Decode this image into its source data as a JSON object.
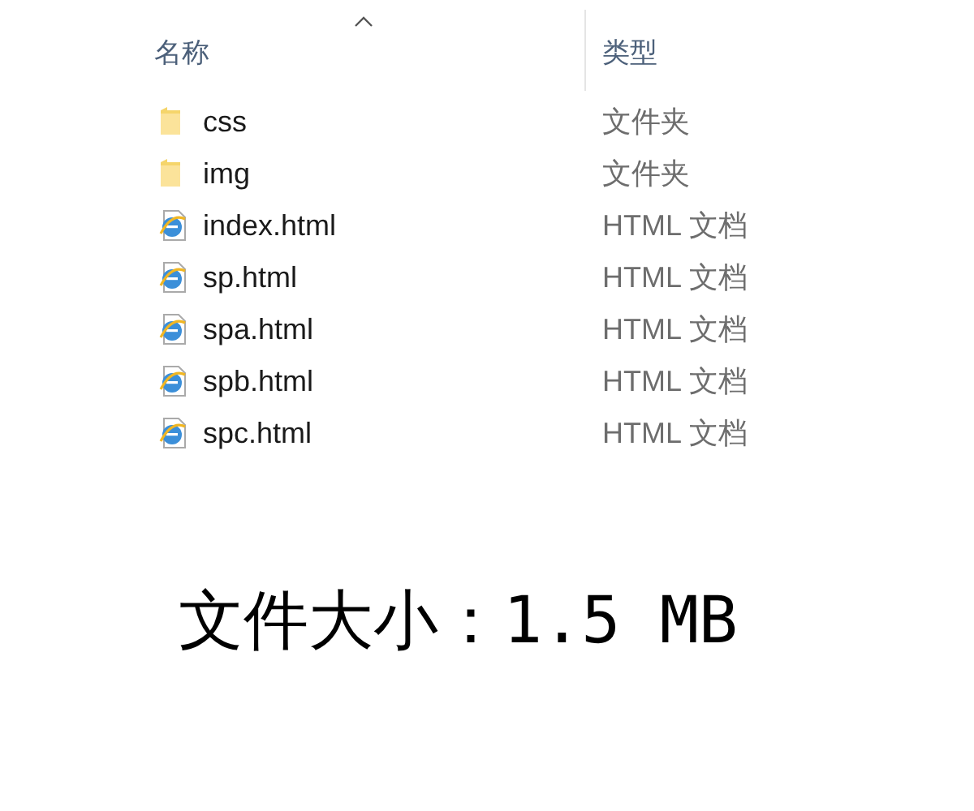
{
  "columns": [
    {
      "label": "名称",
      "sorted": true
    },
    {
      "label": "类型",
      "sorted": false
    }
  ],
  "files": [
    {
      "kind": "folder",
      "name": "css",
      "type": "文件夹"
    },
    {
      "kind": "folder",
      "name": "img",
      "type": "文件夹"
    },
    {
      "kind": "html",
      "name": "index.html",
      "type": "HTML 文档"
    },
    {
      "kind": "html",
      "name": "sp.html",
      "type": "HTML 文档"
    },
    {
      "kind": "html",
      "name": "spa.html",
      "type": "HTML 文档"
    },
    {
      "kind": "html",
      "name": "spb.html",
      "type": "HTML 文档"
    },
    {
      "kind": "html",
      "name": "spc.html",
      "type": "HTML 文档"
    }
  ],
  "caption": "文件大小：1.5 MB"
}
